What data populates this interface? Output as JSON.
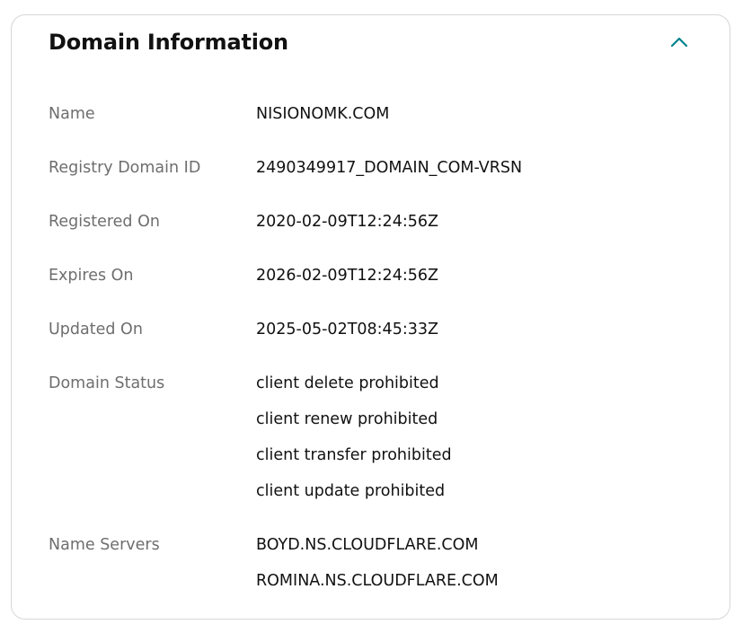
{
  "card": {
    "title": "Domain Information",
    "collapse_icon": "chevron-up-icon",
    "accent_color": "#00838c"
  },
  "rows": {
    "name": {
      "label": "Name",
      "value": "NISIONOMK.COM"
    },
    "registry_id": {
      "label": "Registry Domain ID",
      "value": "2490349917_DOMAIN_COM-VRSN"
    },
    "registered_on": {
      "label": "Registered On",
      "value": "2020-02-09T12:24:56Z"
    },
    "expires_on": {
      "label": "Expires On",
      "value": "2026-02-09T12:24:56Z"
    },
    "updated_on": {
      "label": "Updated On",
      "value": "2025-05-02T08:45:33Z"
    },
    "domain_status": {
      "label": "Domain Status",
      "values": [
        "client delete prohibited",
        "client renew prohibited",
        "client transfer prohibited",
        "client update prohibited"
      ]
    },
    "name_servers": {
      "label": "Name Servers",
      "values": [
        "BOYD.NS.CLOUDFLARE.COM",
        "ROMINA.NS.CLOUDFLARE.COM"
      ]
    }
  }
}
